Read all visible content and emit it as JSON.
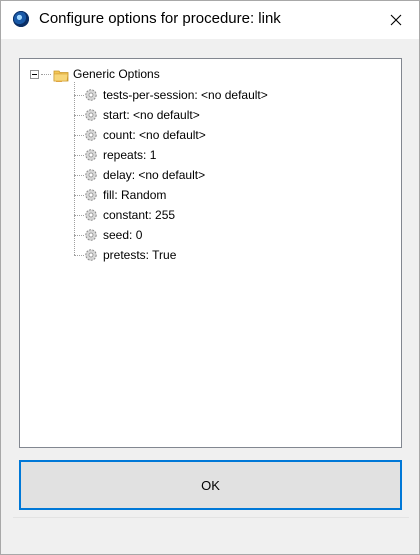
{
  "window": {
    "title": "Configure options for procedure: link"
  },
  "tree": {
    "root_label": "Generic Options",
    "items": [
      {
        "label": "tests-per-session: <no default>"
      },
      {
        "label": "start: <no default>"
      },
      {
        "label": "count: <no default>"
      },
      {
        "label": "repeats: 1"
      },
      {
        "label": "delay: <no default>"
      },
      {
        "label": "fill: Random"
      },
      {
        "label": "constant: 255"
      },
      {
        "label": "seed: 0"
      },
      {
        "label": "pretests: True"
      }
    ]
  },
  "buttons": {
    "ok_label": "OK"
  },
  "icons": {
    "app": "app-icon",
    "close": "close-icon",
    "folder": "folder-icon",
    "item": "gear-icon",
    "expander": "collapse-icon"
  },
  "colors": {
    "focus_border": "#0078d7",
    "button_bg": "#e1e1e1",
    "dialog_bg": "#f0f0f0"
  }
}
